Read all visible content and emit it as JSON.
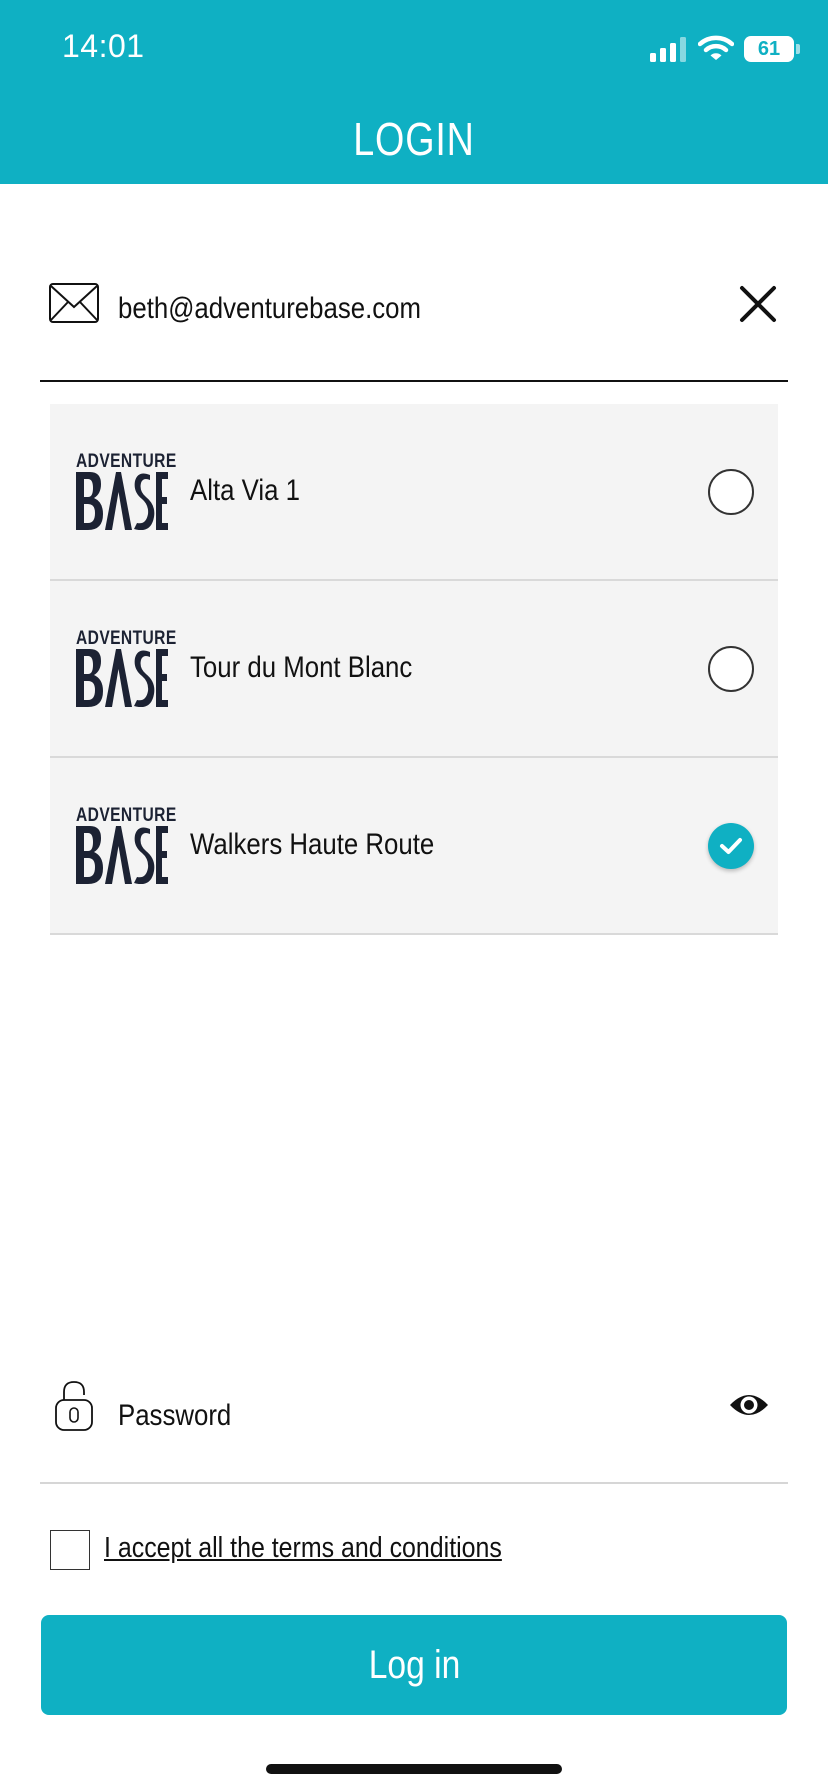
{
  "status_bar": {
    "time": "14:01",
    "battery": "61"
  },
  "header": {
    "title": "LOGIN"
  },
  "email": {
    "value": "beth@adventurebase.com"
  },
  "accounts": [
    {
      "logo_top": "ADVENTURE",
      "logo_bottom": "BASE",
      "name": "Alta Via 1",
      "selected": false
    },
    {
      "logo_top": "ADVENTURE",
      "logo_bottom": "BASE",
      "name": "Tour du Mont Blanc",
      "selected": false
    },
    {
      "logo_top": "ADVENTURE",
      "logo_bottom": "BASE",
      "name": "Walkers Haute Route",
      "selected": true
    }
  ],
  "password": {
    "placeholder": "Password"
  },
  "terms": {
    "label": "I accept all the terms and conditions",
    "checked": false
  },
  "login_button": {
    "label": "Log in"
  },
  "colors": {
    "accent": "#0fb0c3",
    "logo": "#1c2233",
    "row_bg": "#f4f4f4"
  },
  "icons": [
    "mail-icon",
    "close-icon",
    "lock-icon",
    "eye-icon",
    "checkmark-icon",
    "wifi-icon",
    "cellular-signal-icon",
    "battery-icon"
  ]
}
